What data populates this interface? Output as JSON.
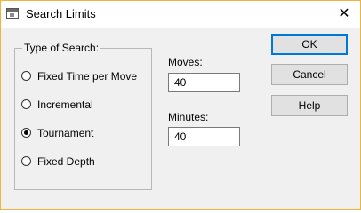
{
  "window": {
    "title": "Search Limits",
    "close_glyph": "✕",
    "app_icon": "dialog-window-icon",
    "accent_color": "#0078d7",
    "frame_color": "#f0b43c"
  },
  "search_type": {
    "label": "Type of Search:",
    "options": [
      {
        "label": "Fixed Time per Move",
        "selected": false
      },
      {
        "label": "Incremental",
        "selected": false
      },
      {
        "label": "Tournament",
        "selected": true
      },
      {
        "label": "Fixed Depth",
        "selected": false
      }
    ]
  },
  "moves": {
    "label": "Moves:",
    "value": "40"
  },
  "minutes": {
    "label": "Minutes:",
    "value": "40"
  },
  "buttons": {
    "ok": "OK",
    "cancel": "Cancel",
    "help": "Help"
  }
}
